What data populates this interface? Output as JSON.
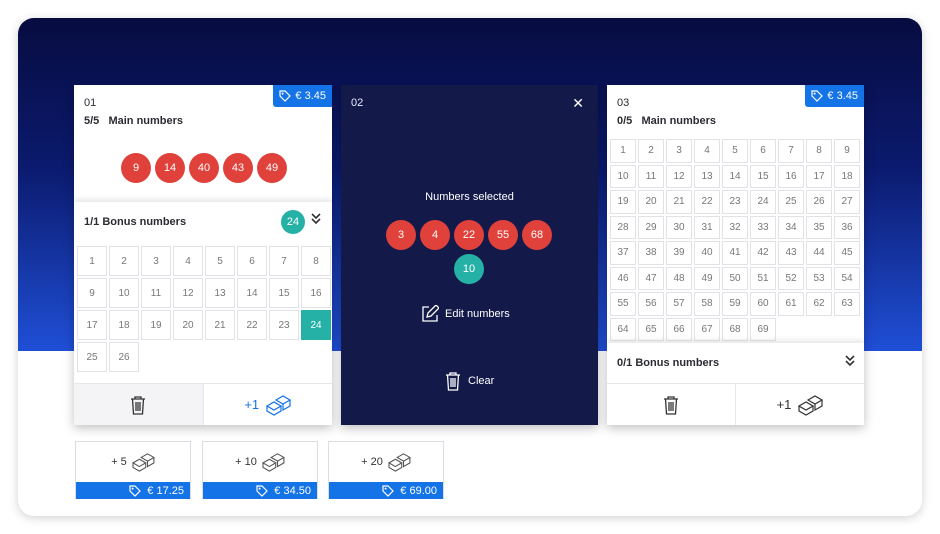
{
  "cards": [
    {
      "number": "01",
      "price": "€ 3.45",
      "main_count": "5/5",
      "main_label": "Main numbers",
      "main_selected": [
        "9",
        "14",
        "40",
        "43",
        "49"
      ],
      "bonus_header": "1/1 Bonus numbers",
      "bonus_selected": "24",
      "bonus_grid": [
        "1",
        "2",
        "3",
        "4",
        "5",
        "6",
        "7",
        "8",
        "9",
        "10",
        "11",
        "12",
        "13",
        "14",
        "15",
        "16",
        "17",
        "18",
        "19",
        "20",
        "21",
        "22",
        "23",
        "24",
        "25",
        "26"
      ],
      "quick_pick_label": "+1"
    },
    {
      "number": "02",
      "overlay_title": "Numbers selected",
      "main_selected": [
        "3",
        "4",
        "22",
        "55",
        "68"
      ],
      "bonus_selected": "10",
      "edit_label": "Edit numbers",
      "clear_label": "Clear"
    },
    {
      "number": "03",
      "price": "€ 3.45",
      "main_count": "0/5",
      "main_label": "Main numbers",
      "main_grid": [
        "1",
        "2",
        "3",
        "4",
        "5",
        "6",
        "7",
        "8",
        "9",
        "10",
        "11",
        "12",
        "13",
        "14",
        "15",
        "16",
        "17",
        "18",
        "19",
        "20",
        "21",
        "22",
        "23",
        "24",
        "25",
        "26",
        "27",
        "28",
        "29",
        "30",
        "31",
        "32",
        "33",
        "34",
        "35",
        "36",
        "37",
        "38",
        "39",
        "40",
        "41",
        "42",
        "43",
        "44",
        "45",
        "46",
        "47",
        "48",
        "49",
        "50",
        "51",
        "52",
        "53",
        "54",
        "55",
        "56",
        "57",
        "58",
        "59",
        "60",
        "61",
        "62",
        "63",
        "64",
        "65",
        "66",
        "67",
        "68",
        "69"
      ],
      "bonus_header": "0/1 Bonus numbers",
      "quick_pick_label": "+1"
    }
  ],
  "quick_picks": [
    {
      "label": "+ 5",
      "price": "€ 17.25"
    },
    {
      "label": "+ 10",
      "price": "€ 34.50"
    },
    {
      "label": "+ 20",
      "price": "€ 69.00"
    }
  ],
  "colors": {
    "hero_dark": "#070c40",
    "hero_light": "#1f4fd6",
    "accent_blue": "#1473e6",
    "ball_red": "#e0413a",
    "ball_teal": "#26b1a6",
    "overlay_bg": "#131a4a"
  },
  "icons": {
    "price": "tag-icon",
    "close": "close-icon",
    "collapse": "double-chevron-icon",
    "delete": "trash-icon",
    "quick_pick": "dice-icon",
    "edit": "edit-icon"
  }
}
